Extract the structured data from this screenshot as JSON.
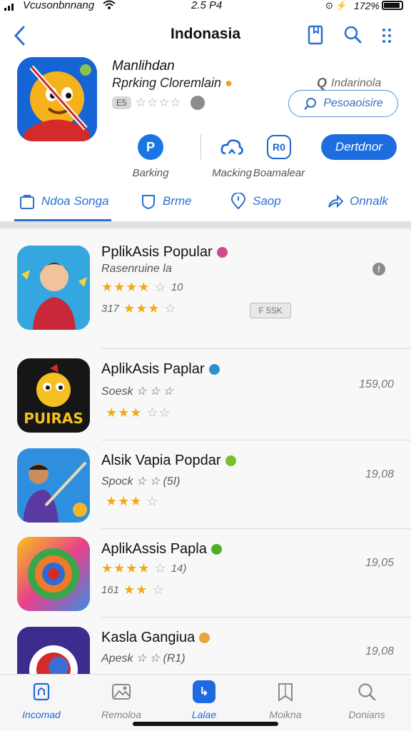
{
  "status_bar": {
    "carrier": "Vcusonbnnang",
    "time": "2.5 P4",
    "battery": "172%"
  },
  "header": {
    "title": "Indonasia"
  },
  "app": {
    "name": "Manlihdan",
    "subtitle": "Rprking Cloremlain",
    "rating_badge": "E5",
    "region": "Indarinola",
    "region_button": "Pesoaoisire"
  },
  "actions": [
    {
      "label": "Barking",
      "icon": "P"
    },
    {
      "label": "Macking",
      "icon": "cloud-icon"
    },
    {
      "label": "Boamalear",
      "icon": "R0"
    }
  ],
  "primary_button": "Dertdnor",
  "tabs": [
    "Ndoa Songa",
    "Brme",
    "Saop",
    "Onnalk"
  ],
  "list": [
    {
      "title": "PplikAsis Popular",
      "sub": "Rasenruine la",
      "stars_gold": "★★★★",
      "stars_grey": "☆",
      "count": "10",
      "line3_num": "317",
      "stars3_gold": "★★★",
      "stars3_grey": "☆",
      "badge": "F 5SK",
      "accent": "#d04a8c"
    },
    {
      "title": "AplikAsis Paplar",
      "sub": "Soesk ☆ ☆ ☆",
      "value": "159,00",
      "stars_gold": "★★★",
      "stars_grey": "☆☆",
      "accent": "#2d8fd0"
    },
    {
      "title": "Alsik Vapia Popdar",
      "sub": "Spock ☆ ☆  (5I)",
      "value": "19,08",
      "stars_gold": "★★★",
      "stars_grey": "☆",
      "accent": "#7bbf2a"
    },
    {
      "title": "AplikAssis Papla",
      "sub": "",
      "stars_gold": "★★★★",
      "stars_grey": "☆",
      "count": "14)",
      "line3_num": "161",
      "stars3_gold": "★★",
      "stars3_grey": "☆",
      "value": "19,05",
      "accent": "#4ab02a"
    },
    {
      "title": "Kasla Gangiua",
      "sub": "Apesk ☆ ☆  (R1)",
      "value": "19,08",
      "accent": "#e8a43a"
    }
  ],
  "tabbar": [
    {
      "label": "Incomad"
    },
    {
      "label": "Remoloa"
    },
    {
      "label": "Lalae",
      "active_icon": "↳"
    },
    {
      "label": "Moikna"
    },
    {
      "label": "Donians"
    }
  ]
}
